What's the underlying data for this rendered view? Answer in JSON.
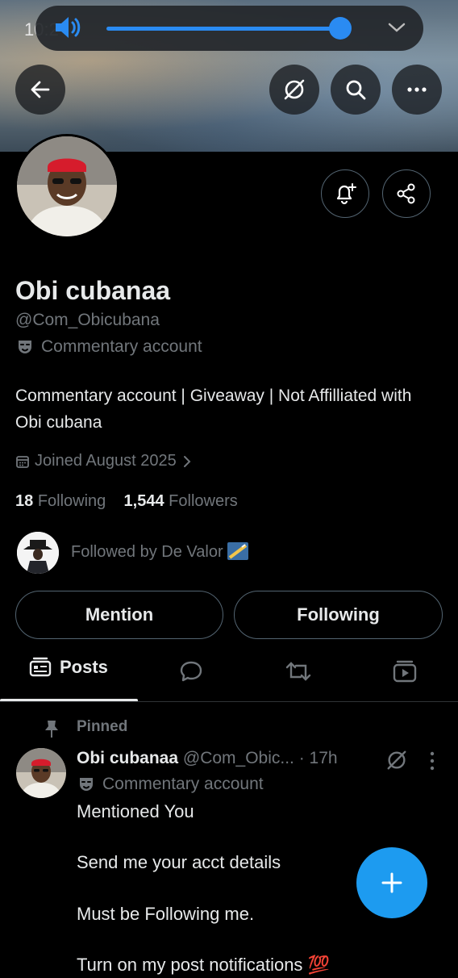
{
  "status_bar": {
    "time": "10:2"
  },
  "volume_panel": {
    "level": 0.97,
    "accent": "#2a8bf2"
  },
  "header": {
    "back_icon": "arrow-left-icon",
    "grok_icon": "grok-slash-circle-icon",
    "search_icon": "search-icon",
    "more_icon": "more-horizontal-icon"
  },
  "profile": {
    "display_name": "Obi cubanaa",
    "handle": "@Com_Obicubana",
    "account_label": "Commentary account",
    "bio": "Commentary account | Giveaway | Not Affilliated with Obi cubana",
    "joined": "Joined August 2025",
    "following_count": "18",
    "following_label": "Following",
    "followers_count": "1,544",
    "followers_label": "Followers",
    "followed_by": "Followed by De Valor"
  },
  "actions": {
    "mention": "Mention",
    "following": "Following"
  },
  "tabs": [
    {
      "label": "Posts",
      "icon": "posts-icon",
      "active": true
    },
    {
      "label": "",
      "icon": "reply-icon"
    },
    {
      "label": "",
      "icon": "repost-icon"
    },
    {
      "label": "",
      "icon": "media-icon"
    }
  ],
  "post": {
    "pinned_label": "Pinned",
    "author": "Obi cubanaa",
    "handle_time": "@Com_Obic... · 17h",
    "account_label": "Commentary account",
    "text": "Mentioned You\n\nSend me your acct details\n\nMust be Following me.\n\nTurn on my post notifications 💯"
  },
  "colors": {
    "accent": "#1d9bf0",
    "muted": "#71767b",
    "text": "#e7e9ea",
    "border": "#536471"
  }
}
